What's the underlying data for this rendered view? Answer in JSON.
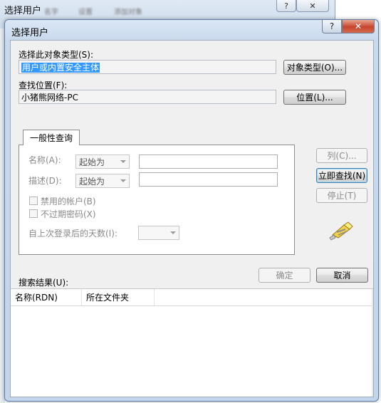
{
  "background_window": {
    "title": "选择用户",
    "blurred": [
      "名字",
      "设置",
      "添加对象"
    ],
    "help_glyph": "?",
    "close_glyph": "✕"
  },
  "dialog": {
    "title": "选择用户",
    "help_glyph": "?",
    "close_glyph": "✕"
  },
  "object_type": {
    "label": "选择此对象类型(S):",
    "value": "用户或内置安全主体",
    "button": "对象类型(O)..."
  },
  "location": {
    "label": "查找位置(F):",
    "value": "小猪熊网络-PC",
    "button": "位置(L)..."
  },
  "tab": {
    "label": "一般性查询",
    "name_label": "名称(A):",
    "name_mode": "起始为",
    "desc_label": "描述(D):",
    "desc_mode": "起始为",
    "disabled_accounts": "禁用的帐户(B)",
    "non_expiring_pw": "不过期密码(X)",
    "days_since_login": "自上次登录后的天数(I):"
  },
  "side_buttons": {
    "columns": "列(C)...",
    "find_now": "立即查找(N)",
    "stop": "停止(T)"
  },
  "footer": {
    "ok": "确定",
    "cancel": "取消",
    "results_label": "搜索结果(U):"
  },
  "results_columns": [
    "名称(RDN)",
    "所在文件夹"
  ],
  "icons": {
    "search": "flashlight-search-icon"
  }
}
